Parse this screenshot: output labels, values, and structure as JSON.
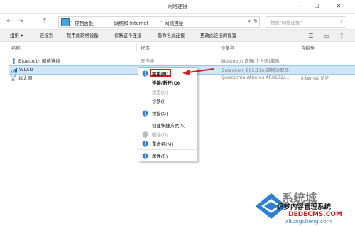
{
  "window": {
    "title": "网络连接",
    "buttons": {
      "minimize": "—",
      "maximize": "☐",
      "close": "✕"
    }
  },
  "address": {
    "nav": {
      "back": "←",
      "forward": "→",
      "up": "↑"
    },
    "breadcrumb": [
      "控制面板",
      "网络和 Internet",
      "网络连接"
    ],
    "search_placeholder": "搜索\"网络连接\""
  },
  "toolbar": {
    "items": [
      "组织 ▾",
      "连接到",
      "禁用此网络设备",
      "诊断这个连接",
      "重命名此连接",
      "更改此连接的设置"
    ],
    "right_icons": [
      "view-icon",
      "preview-pane-icon",
      "help-icon"
    ]
  },
  "columns": [
    "名称",
    "状态",
    "设备名",
    "连接性"
  ],
  "rows": [
    {
      "name": "Bluetooth 网络连接",
      "status": "未连接",
      "device": "Bluetooth 设备(个人区域网)",
      "connectivity": ""
    },
    {
      "name": "WLAN",
      "status": "",
      "device": "Broadcom 802.11n 网络适配器",
      "connectivity": ""
    },
    {
      "name": "以太网",
      "status": "",
      "device": "Qualcomm Atheros AR8172/...",
      "connectivity": "Internet 访问"
    }
  ],
  "context_menu": {
    "items": [
      {
        "label": "禁用(B)"
      },
      {
        "label": "连接/断开(O)"
      },
      {
        "label": "状态(U)"
      },
      {
        "label": "诊断(I)"
      },
      {
        "label": "桥接(G)"
      },
      {
        "label": "创建快捷方式(S)"
      },
      {
        "label": "删除(D)"
      },
      {
        "label": "重命名(M)"
      },
      {
        "label": "属性(R)"
      }
    ]
  },
  "watermark": {
    "brand": "系统城",
    "line2": "织梦内容管理系统",
    "line3": "DEDECMS.COM",
    "line4": "xitongcheng.com"
  },
  "colors": {
    "accent": "#1f6fb4",
    "selection": "#cfe6f8",
    "annotation": "#e11b1b"
  }
}
